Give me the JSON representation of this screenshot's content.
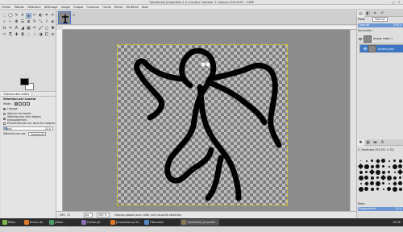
{
  "window": {
    "title": "*[Sadanse] (importée)-1.0 (Couleur indexée, 2 calques) 341x333 – GIMP",
    "controls": [
      "–",
      "□",
      "✕"
    ]
  },
  "menu": [
    "Fichier",
    "Édition",
    "Sélection",
    "Affichage",
    "Image",
    "Calque",
    "Couleurs",
    "Outils",
    "Filtres",
    "Fenêtres",
    "Aide"
  ],
  "tools": [
    "rect-select-icon",
    "ellipse-select-icon",
    "free-select-icon",
    "fuzzy-select-icon",
    "color-select-icon",
    "scissors-icon",
    "foreground-select-icon",
    "paths-icon",
    "color-picker-icon",
    "zoom-icon",
    "measure-icon",
    "move-icon",
    "align-icon",
    "crop-icon",
    "rotate-icon",
    "scale-icon",
    "shear-icon",
    "perspective-icon",
    "flip-icon",
    "cage-icon",
    "text-icon",
    "bucket-fill-icon",
    "blend-icon",
    "pencil-icon",
    "paintbrush-icon",
    "eraser-icon",
    "airbrush-icon",
    "ink-icon",
    "clone-icon",
    "heal-icon",
    "perspective-clone-icon",
    "blur-icon",
    "smudge-icon",
    "dodge-icon",
    "unified-transform-icon",
    "warp-icon"
  ],
  "tool_glyphs": [
    "⬚",
    "◯",
    "✎",
    "✦",
    "◈",
    "✂",
    "◐",
    "✒",
    "✐",
    "⌕",
    "⊢",
    "✥",
    "☰",
    "⧈",
    "↻",
    "⤡",
    "⫽",
    "⬖",
    "⇆",
    "⌗",
    "A",
    "◢",
    "▦",
    "✏",
    "🖌",
    "◻",
    "✺",
    "✑",
    "⎘",
    "✚",
    "⧉",
    "◌",
    "☝",
    "◑",
    "⧠",
    "≋"
  ],
  "active_tool_index": 4,
  "tool_options": {
    "tabs": [
      "Options des outils"
    ],
    "heading": "Sélection par couleur",
    "mode_label": "Mode :",
    "antialias_label": "Lissage",
    "antialias_on": true,
    "feather_label": "Adoucir les bords",
    "feather_on": false,
    "transparent_label": "Sélectionner des régions transparentes",
    "transparent_on": true,
    "sample_merged_label": "Échantillonner sur tous les calques",
    "sample_merged_on": false,
    "threshold_label": "Seuil",
    "threshold_value": "15,0",
    "threshold_fraction": 0.06,
    "select_by_label": "Sélectionner par",
    "select_by_value": "Composite"
  },
  "status": {
    "coords": "295, 73",
    "unit": "px",
    "zoom": "100 %",
    "message": "Cliquez-glissez pour créer une nouvelle sélection"
  },
  "right_dock": {
    "mode_label": "Mode",
    "mode_value": "Normal",
    "opacity_label": "Opacité",
    "opacity_value": "100,0",
    "lock_label": "Verrouiller :",
    "layers": [
      {
        "name": "Image index 1",
        "visible": true,
        "selected": false
      },
      {
        "name": "Arrière-plan",
        "visible": true,
        "selected": true
      }
    ],
    "brush_name": "2. Hardness 050 (51 × 51)",
    "brush_sizes": [
      1,
      2,
      3,
      4,
      5,
      2,
      3,
      4,
      5,
      6,
      4,
      5,
      3,
      2,
      6,
      5,
      4,
      3,
      5,
      6,
      4,
      3,
      2,
      5,
      6,
      5,
      4,
      3,
      5,
      6,
      4,
      3,
      2,
      4,
      5,
      6,
      3,
      2,
      4,
      5,
      6,
      5,
      4,
      3,
      2,
      5,
      6,
      4
    ],
    "basic_label": "Basic",
    "spacing_label": "Espacement",
    "spacing_value": "10,0"
  },
  "taskbar": {
    "items": [
      {
        "label": "Menu",
        "color": "#7fb84a",
        "active": false
      },
      {
        "label": "Erreur de serveur...",
        "color": "#e0792a",
        "active": false
      },
      {
        "label": "[Slack - FabAcade...",
        "color": "#4a9b6a",
        "active": false
      },
      {
        "label": "Fichier gif Image...",
        "color": "#8a6fb4",
        "active": false
      },
      {
        "label": "[Invocation pi et...",
        "color": "#e0792a",
        "active": false
      },
      {
        "label": "*Nouveau documen...",
        "color": "#5a8ac8",
        "active": false
      },
      {
        "label": "*[Sadanse] (importé...",
        "color": "#8a7a55",
        "active": true
      }
    ],
    "clock": "16:38"
  }
}
